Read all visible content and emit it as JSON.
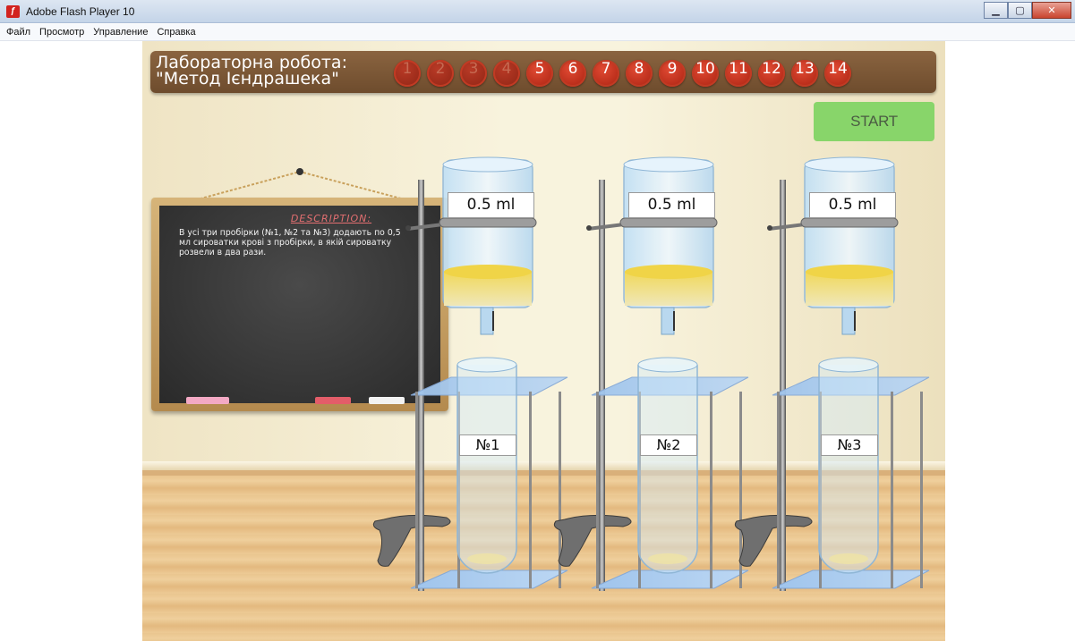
{
  "window": {
    "title": "Adobe Flash Player 10",
    "icon": "flash-player-icon",
    "controls": [
      "minimize",
      "maximize",
      "close"
    ]
  },
  "menu": {
    "items": [
      {
        "label": "Файл",
        "name": "menu-file"
      },
      {
        "label": "Просмотр",
        "name": "menu-view"
      },
      {
        "label": "Управление",
        "name": "menu-control"
      },
      {
        "label": "Справка",
        "name": "menu-help"
      }
    ]
  },
  "header": {
    "title": "Лабораторна робота: \"Метод Ієндрашека\"",
    "steps": [
      "1",
      "2",
      "3",
      "4",
      "5",
      "6",
      "7",
      "8",
      "9",
      "10",
      "11",
      "12",
      "13",
      "14"
    ],
    "completed_steps": 4
  },
  "start_button": {
    "label": "START"
  },
  "description": {
    "heading": "DESCRIPTION:",
    "text": "В усі три пробірки (№1, №2 та №3) додають по 0,5 мл сироватки крові з пробірки, в якій сироватку розвели в два рази."
  },
  "stations": [
    {
      "volume": "0.5 ml",
      "tube": "№1"
    },
    {
      "volume": "0.5 ml",
      "tube": "№2"
    },
    {
      "volume": "0.5 ml",
      "tube": "№3"
    }
  ],
  "colors": {
    "header_bar": "#7b5534",
    "step_circle": "#c02d18",
    "start_button": "#88d56a",
    "liquid": "#f3dd6a",
    "glass": "#c8e2f5",
    "stand_plate": "#a5c8ee"
  }
}
